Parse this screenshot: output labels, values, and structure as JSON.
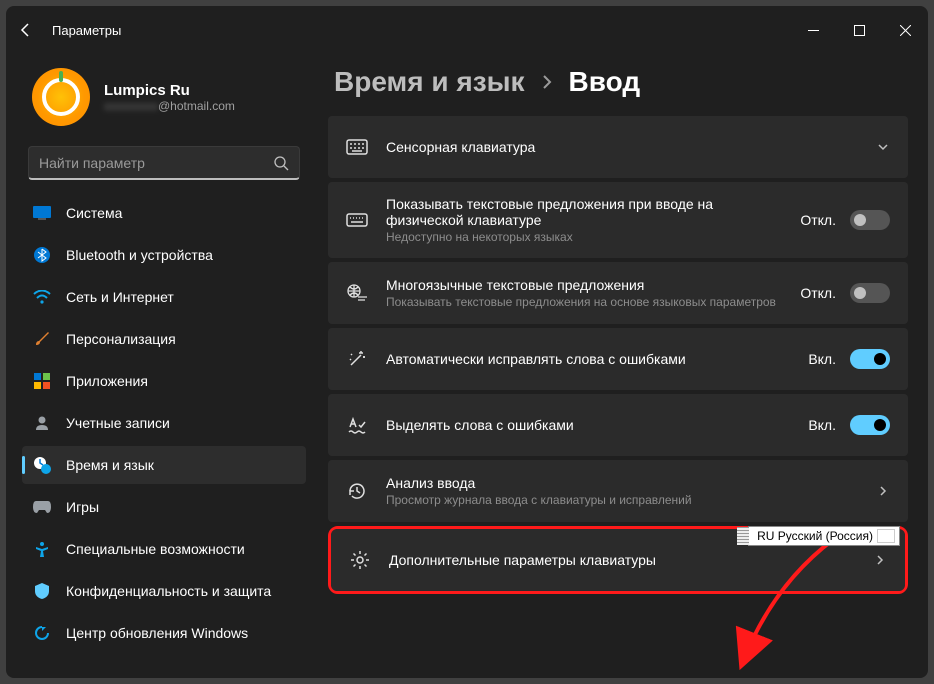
{
  "window": {
    "title": "Параметры"
  },
  "profile": {
    "name": "Lumpics Ru",
    "email_suffix": "@hotmail.com"
  },
  "search": {
    "placeholder": "Найти параметр"
  },
  "sidebar": {
    "items": [
      {
        "label": "Система"
      },
      {
        "label": "Bluetooth и устройства"
      },
      {
        "label": "Сеть и Интернет"
      },
      {
        "label": "Персонализация"
      },
      {
        "label": "Приложения"
      },
      {
        "label": "Учетные записи"
      },
      {
        "label": "Время и язык"
      },
      {
        "label": "Игры"
      },
      {
        "label": "Специальные возможности"
      },
      {
        "label": "Конфиденциальность и защита"
      },
      {
        "label": "Центр обновления Windows"
      }
    ]
  },
  "breadcrumbs": {
    "parent": "Время и язык",
    "current": "Ввод"
  },
  "settings": [
    {
      "title": "Сенсорная клавиатура",
      "sub": "",
      "state": "",
      "action": "expand"
    },
    {
      "title": "Показывать текстовые предложения при вводе на физической клавиатуре",
      "sub": "Недоступно на некоторых языках",
      "state": "Откл.",
      "toggle": false
    },
    {
      "title": "Многоязычные текстовые предложения",
      "sub": "Показывать текстовые предложения на основе языковых параметров",
      "state": "Откл.",
      "toggle": false
    },
    {
      "title": "Автоматически исправлять слова с ошибками",
      "sub": "",
      "state": "Вкл.",
      "toggle": true
    },
    {
      "title": "Выделять слова с ошибками",
      "sub": "",
      "state": "Вкл.",
      "toggle": true
    },
    {
      "title": "Анализ ввода",
      "sub": "Просмотр журнала ввода с клавиатуры и исправлений",
      "state": "",
      "action": "nav"
    },
    {
      "title": "Дополнительные параметры клавиатуры",
      "sub": "",
      "state": "",
      "action": "nav"
    }
  ],
  "lang_badge": "RU Русский (Россия)"
}
